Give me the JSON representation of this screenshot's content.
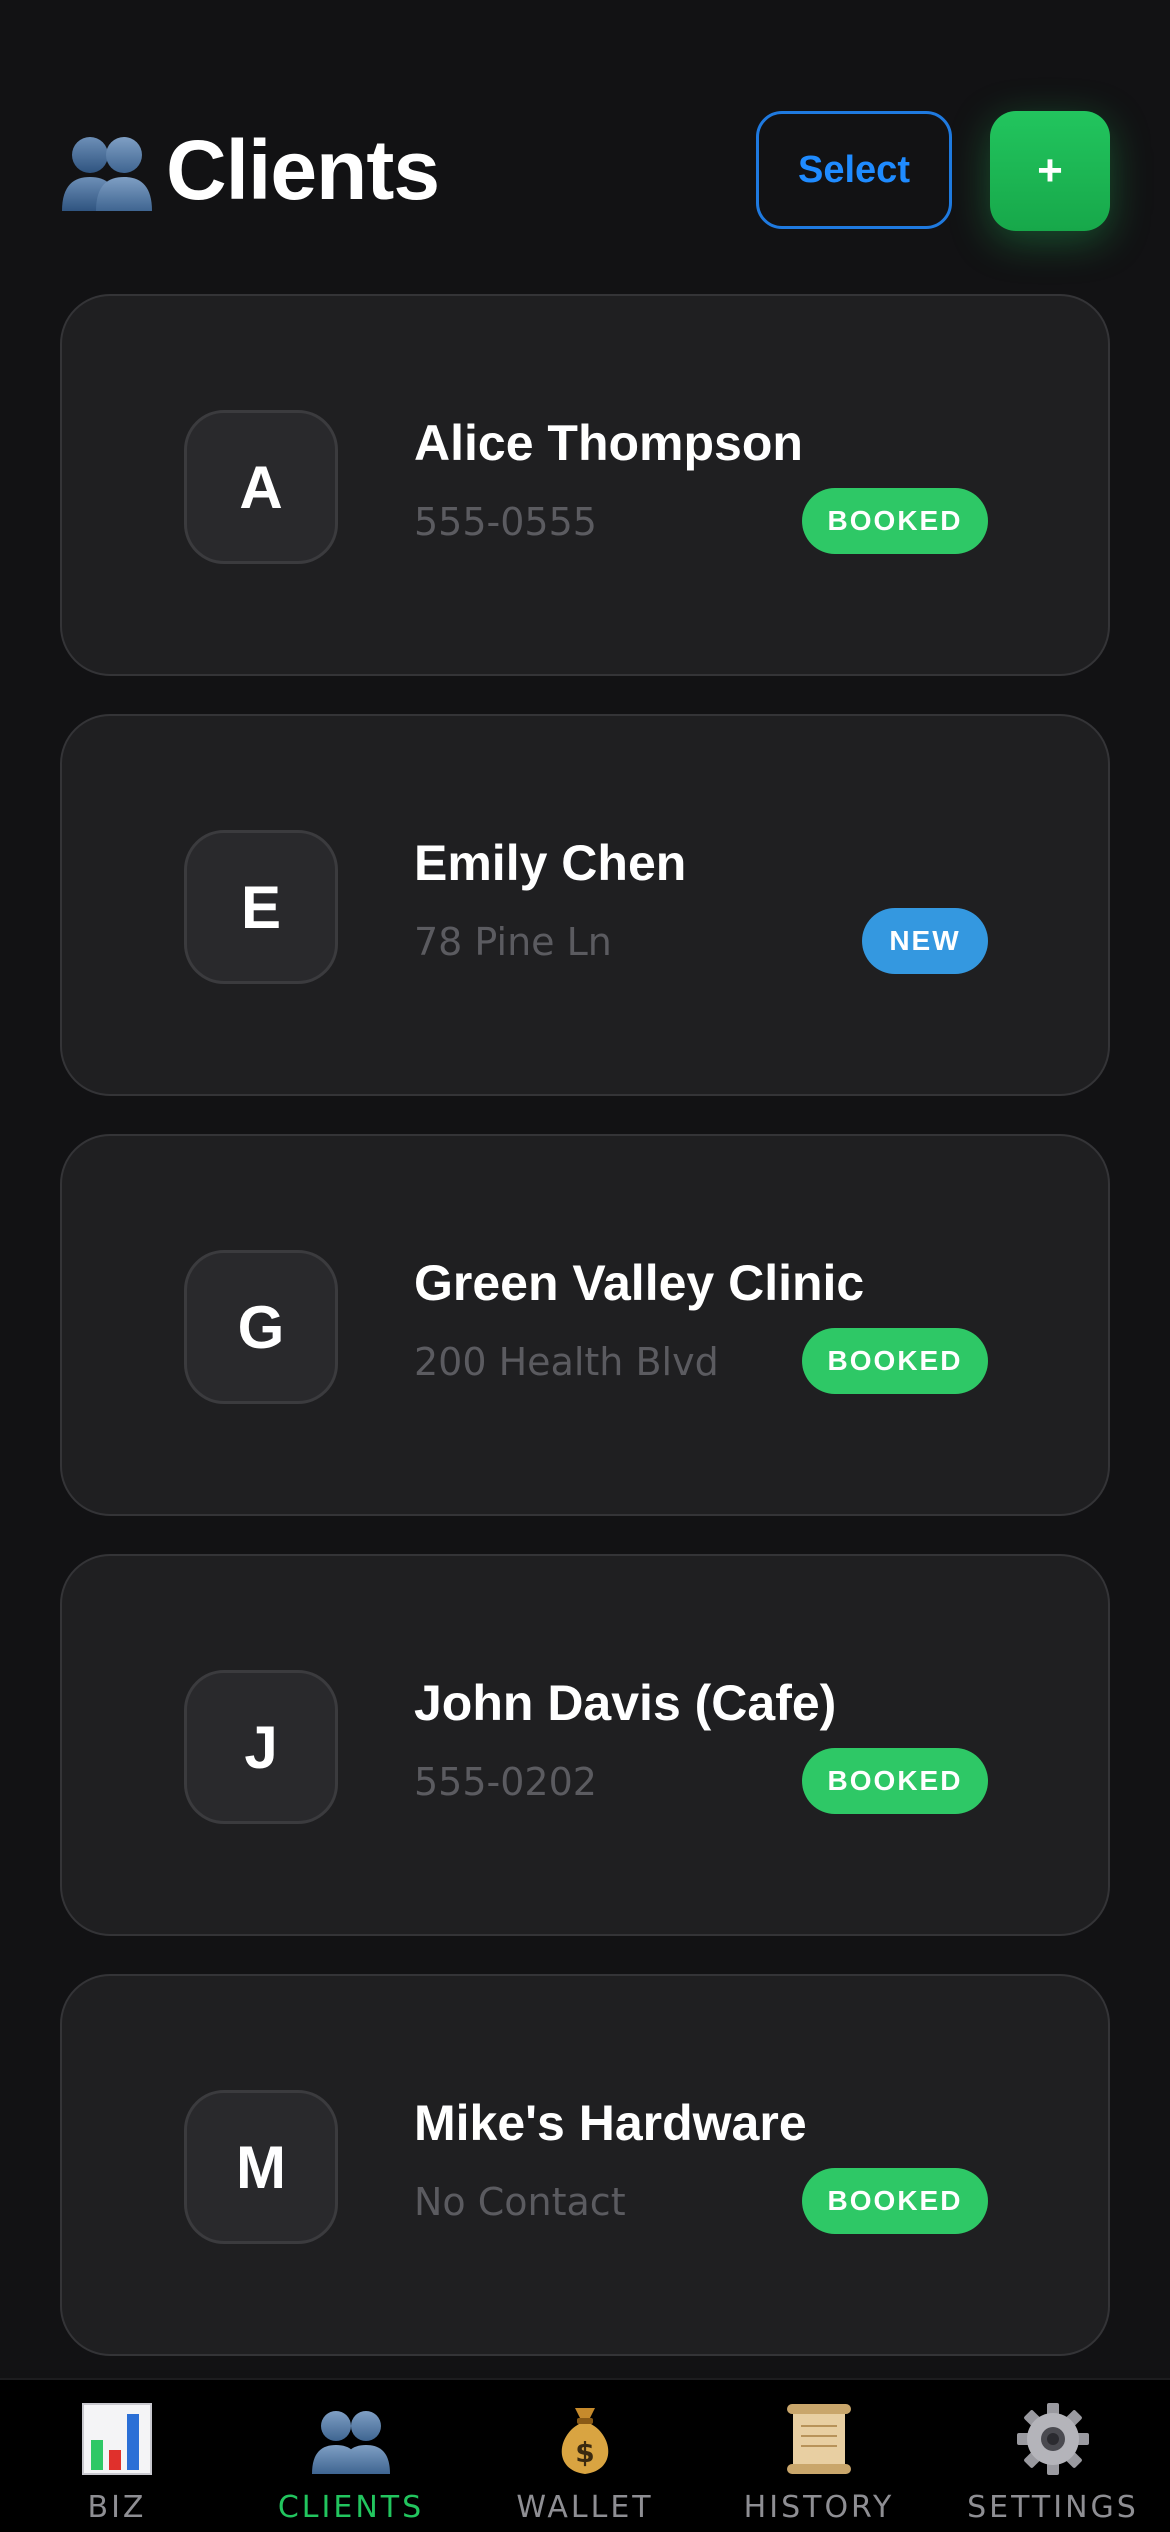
{
  "header": {
    "title_icon": "busts-in-silhouette-icon",
    "title": "Clients",
    "select_label": "Select",
    "add_label": "+"
  },
  "clients": [
    {
      "initial": "A",
      "name": "Alice Thompson",
      "detail": "555-0555",
      "status": "BOOKED",
      "status_color": "#2ec866"
    },
    {
      "initial": "E",
      "name": "Emily Chen",
      "detail": "78 Pine Ln",
      "status": "NEW",
      "status_color": "#3498e0"
    },
    {
      "initial": "G",
      "name": "Green Valley Clinic",
      "detail": "200 Health Blvd",
      "status": "BOOKED",
      "status_color": "#2ec866"
    },
    {
      "initial": "J",
      "name": "John Davis (Cafe)",
      "detail": "555-0202",
      "status": "BOOKED",
      "status_color": "#2ec866"
    },
    {
      "initial": "M",
      "name": "Mike's Hardware",
      "detail": "No Contact",
      "status": "BOOKED",
      "status_color": "#2ec866"
    }
  ],
  "tabs": [
    {
      "icon": "bar-chart-icon",
      "label": "BIZ",
      "active": false
    },
    {
      "icon": "busts-in-silhouette-icon",
      "label": "CLIENTS",
      "active": true
    },
    {
      "icon": "money-bag-icon",
      "label": "WALLET",
      "active": false
    },
    {
      "icon": "scroll-icon",
      "label": "HISTORY",
      "active": false
    },
    {
      "icon": "gear-icon",
      "label": "SETTINGS",
      "active": false
    }
  ],
  "colors": {
    "accent": "#22c55e",
    "select_blue": "#1f8bff",
    "background": "#121214",
    "card": "#1f1f21"
  }
}
